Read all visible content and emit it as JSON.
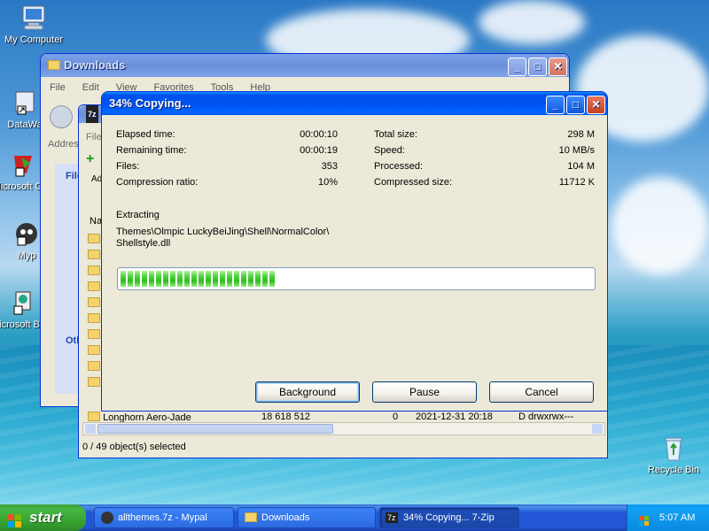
{
  "desktop": {
    "icons": [
      {
        "label": "My Computer"
      },
      {
        "label": "DataWa"
      },
      {
        "label": "Microsoft C++"
      },
      {
        "label": "Myp"
      },
      {
        "label": "Microsoft Basic"
      },
      {
        "label": "Recycle Bin"
      }
    ]
  },
  "explorer": {
    "title": "Downloads",
    "menu": [
      "File",
      "Edit",
      "View",
      "Favorites",
      "Tools",
      "Help"
    ],
    "address_label": "Addres",
    "sidebar_head1": "File",
    "sidebar_head2": "Oth"
  },
  "zip_window": {
    "menu_partial": "File",
    "toolbar_partial": "Ad",
    "column_name": "Na",
    "last_row": {
      "name": "Longhorn Aero-Jade",
      "size": "18 618 512",
      "packed": "0",
      "modified": "2021-12-31 20:18",
      "attrib": "D drwxrwx---"
    },
    "status": "0 / 49 object(s) selected"
  },
  "progress_dialog": {
    "title": "34% Copying...",
    "left_stats": [
      {
        "label": "Elapsed time:",
        "value": "00:00:10"
      },
      {
        "label": "Remaining time:",
        "value": "00:00:19"
      },
      {
        "label": "Files:",
        "value": "353"
      },
      {
        "label": "Compression ratio:",
        "value": "10%"
      }
    ],
    "right_stats": [
      {
        "label": "Total size:",
        "value": "298 M"
      },
      {
        "label": "Speed:",
        "value": "10 MB/s"
      },
      {
        "label": "Processed:",
        "value": "104 M"
      },
      {
        "label": "Compressed size:",
        "value": "11712 K"
      }
    ],
    "operation": "Extracting",
    "current_path": "Themes\\Olmpic LuckyBeiJing\\Shell\\NormalColor\\",
    "current_file": "Shellstyle.dll",
    "progress_fraction": 0.34,
    "buttons": {
      "background": "Background",
      "pause": "Pause",
      "cancel": "Cancel"
    }
  },
  "taskbar": {
    "start_label": "start",
    "tasks": [
      {
        "label": "allthemes.7z - Mypal"
      },
      {
        "label": "Downloads"
      },
      {
        "label": "34% Copying... 7-Zip"
      }
    ],
    "clock": "5:07 AM"
  },
  "colors": {
    "title_blue": "#0053ee",
    "progress_green": "#2fbf1c",
    "face": "#ece9d8"
  }
}
